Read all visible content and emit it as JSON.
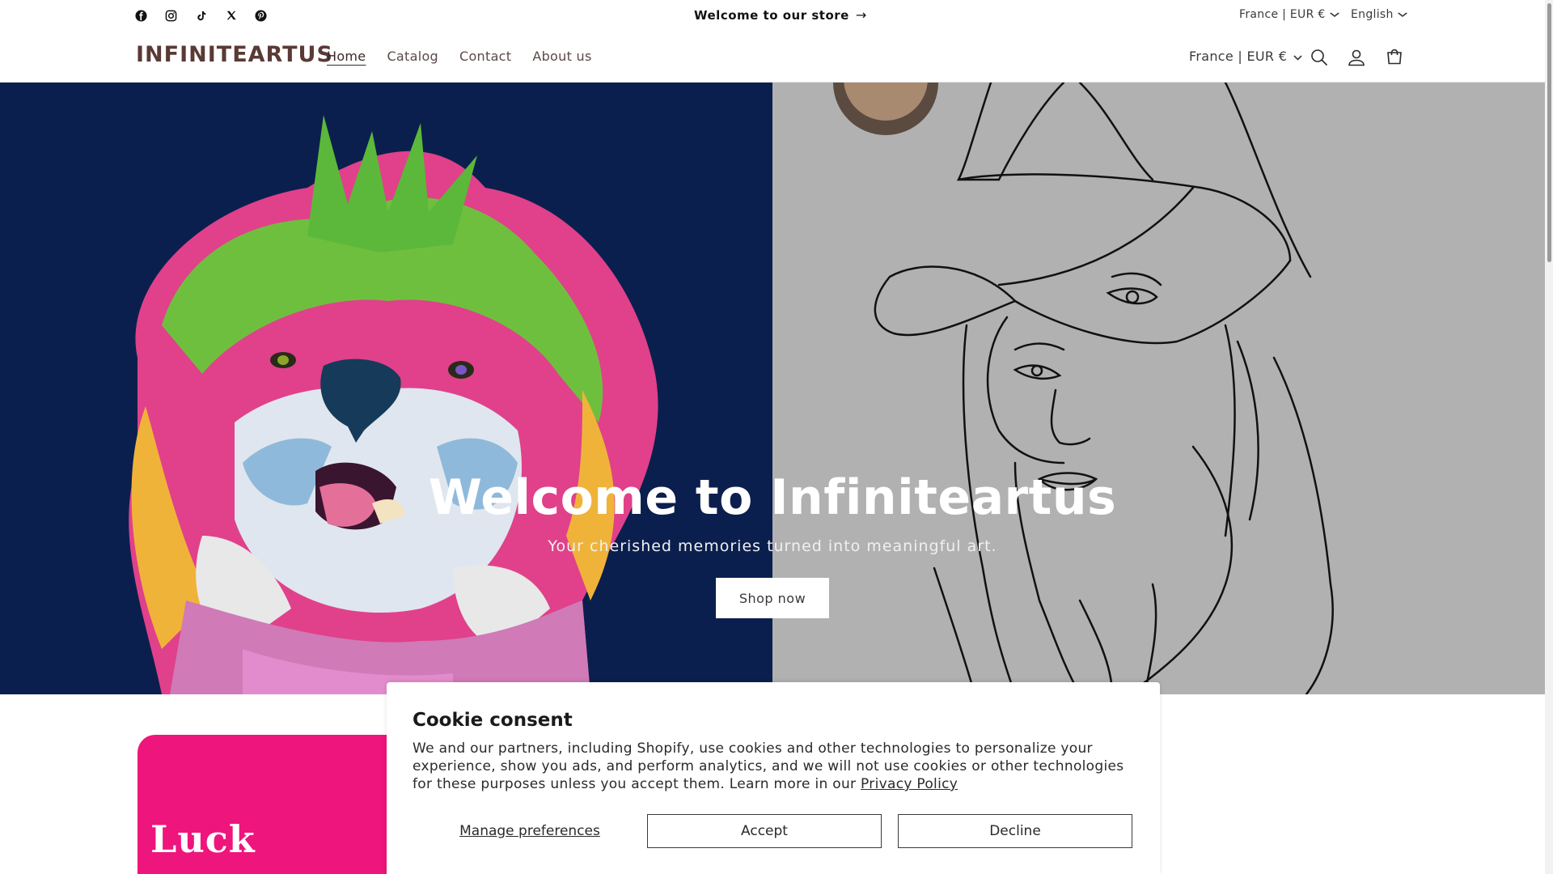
{
  "announcement": {
    "message": "Welcome to our store",
    "arrow": "→",
    "social": [
      "facebook-icon",
      "instagram-icon",
      "tiktok-icon",
      "x-icon",
      "pinterest-icon"
    ],
    "locale": "France | EUR €",
    "language": "English",
    "chevron": "⌄"
  },
  "header": {
    "logo": "INFINITEARTUS",
    "nav": [
      "Home",
      "Catalog",
      "Contact",
      "About us"
    ],
    "active_nav": "Home",
    "locale": "France | EUR €",
    "icons": [
      "search-icon",
      "account-icon",
      "cart-icon"
    ]
  },
  "hero": {
    "title": "Welcome to Infiniteartus",
    "subtitle": "Your cherished memories turned into meaningful art.",
    "button": "Shop now",
    "left_bg": "#0b1f4e",
    "right_bg": "#b1b1b1"
  },
  "promo": {
    "text": "Luck",
    "bg": "#ee157c"
  },
  "cookie": {
    "title": "Cookie consent",
    "body": "We and our partners, including Shopify, use cookies and other technologies to personalize your experience, show you ads, and perform analytics, and we will not use cookies or other technologies for these purposes unless you accept them. Learn more in our",
    "link": "Privacy Policy",
    "manage": "Manage preferences",
    "accept": "Accept",
    "decline": "Decline"
  }
}
